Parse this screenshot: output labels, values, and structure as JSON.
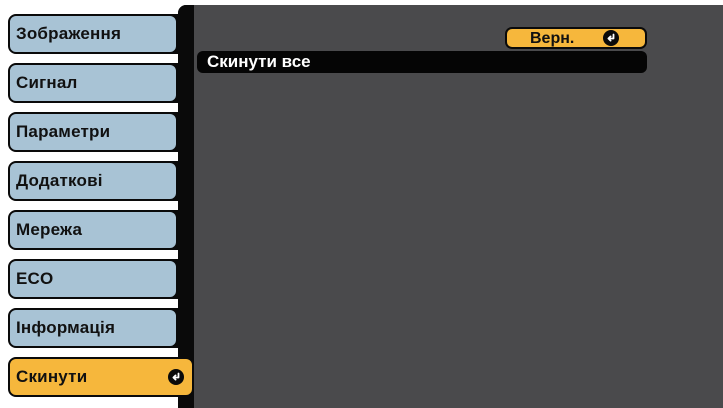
{
  "menu": {
    "items": [
      {
        "label": "Зображення",
        "active": false
      },
      {
        "label": "Сигнал",
        "active": false
      },
      {
        "label": "Параметри",
        "active": false
      },
      {
        "label": "Додаткові",
        "active": false
      },
      {
        "label": "Мережа",
        "active": false
      },
      {
        "label": "ECO",
        "active": false
      },
      {
        "label": "Інформація",
        "active": false
      },
      {
        "label": "Скинути",
        "active": true
      }
    ]
  },
  "panel": {
    "back_label": "Верн.",
    "reset_all_label": "Скинути все"
  },
  "colors": {
    "menu_item": "#a8c3d5",
    "active": "#f6b73c",
    "panel": "#4a4a4c",
    "selected_row": "#050505"
  },
  "icons": {
    "enter": "enter-arrow-icon"
  }
}
